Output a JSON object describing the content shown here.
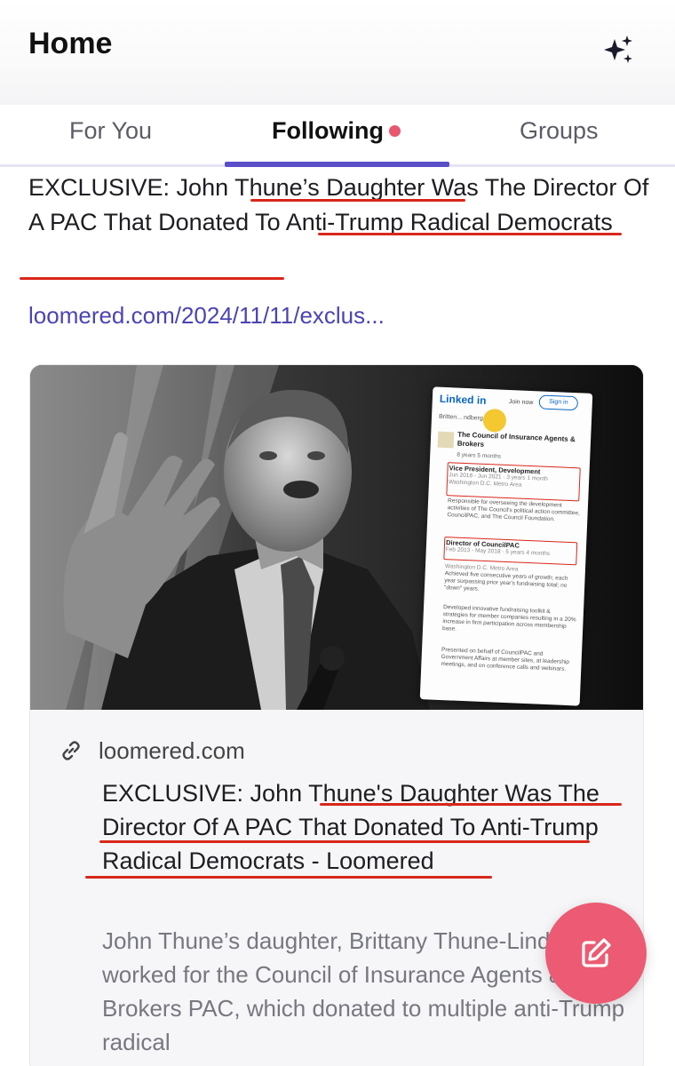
{
  "header": {
    "title": "Home",
    "sparkle_icon": "sparkle-icon"
  },
  "tabs": [
    {
      "label": "For You",
      "active": false
    },
    {
      "label": "Following",
      "active": true,
      "has_dot": true
    },
    {
      "label": "Groups",
      "active": false
    }
  ],
  "post": {
    "headline": "EXCLUSIVE: John Thune’s Daughter Was The Director Of A PAC That Donated To Anti-Trump Radical Democrats",
    "link_text": "loomered.com/2024/11/11/exclus..."
  },
  "card": {
    "domain": "loomered.com",
    "title": "EXCLUSIVE: John Thune's Daughter Was The Director Of A PAC That Donated To Anti-Trump Radical Democrats - Loomered",
    "description": "John Thune’s daughter, Brittany Thune-Lindberg, worked for the Council of Insurance Agents & Brokers PAC, which donated to multiple anti-Trump radical",
    "image": {
      "linkedin": {
        "logo": "Linked in",
        "join": "Join now",
        "sign_in": "Sign in",
        "search": "Britten... ndberg",
        "org": "The Council of Insurance Agents & Brokers",
        "duration": "8 years 5 months",
        "role1": "Vice President, Development",
        "role1_dates": "Jun 2018 - Jun 2021 · 3 years 1 month",
        "role1_loc": "Washington D.C. Metro Area",
        "role1_desc": "Responsible for overseeing the development activities of The Council's political action committee, CouncilPAC, and The Council Foundation.",
        "role2": "Director of CouncilPAC",
        "role2_dates": "Feb 2013 - May 2018 · 5 years 4 months",
        "role2_loc": "Washington D.C. Metro Area",
        "role2_desc": "Achieved five consecutive years of growth; each year surpassing prior year's fundraising total; no \"down\" years.",
        "role2_desc2": "Developed innovative fundraising toolkit & strategies for member companies resulting in a 20% increase in firm participation across membership base.",
        "role2_desc3": "Presented on behalf of CouncilPAC and Government Affairs at member sites, at leadership meetings, and on conference calls and webinars."
      }
    }
  },
  "colors": {
    "accent": "#5b4ec9",
    "dot": "#e8566f",
    "fab": "#ec5b73",
    "underline": "#d9261b"
  },
  "fab": {
    "icon": "edit-icon"
  }
}
